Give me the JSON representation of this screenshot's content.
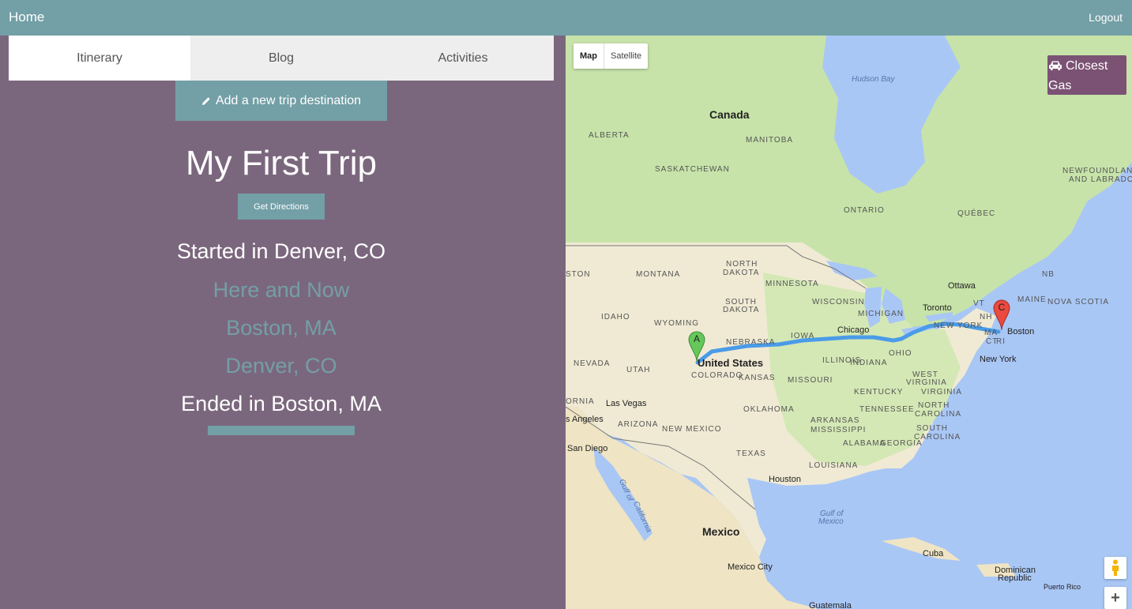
{
  "navbar": {
    "home_label": "Home",
    "logout_label": "Logout"
  },
  "tabs": [
    {
      "label": "Itinerary",
      "active": true
    },
    {
      "label": "Blog",
      "active": false
    },
    {
      "label": "Activities",
      "active": false
    }
  ],
  "actions": {
    "add_destination_label": "Add a new trip destination",
    "get_directions_label": "Get Directions"
  },
  "trip": {
    "title": "My First Trip",
    "start_text": "Started in Denver, CO",
    "stops": [
      "Here and Now",
      "Boston, MA",
      "Denver, CO"
    ],
    "end_text": "Ended in Boston, MA"
  },
  "map": {
    "type_controls": {
      "map_label": "Map",
      "satellite_label": "Satellite",
      "selected": "Map"
    },
    "closest_gas_label": "Closest Gas",
    "markers": {
      "a_label": "A",
      "c_label": "C"
    },
    "labels": {
      "hudson_bay": "Hudson Bay",
      "canada": "Canada",
      "alberta": "ALBERTA",
      "manitoba": "MANITOBA",
      "saskatchewan": "SASKATCHEWAN",
      "ontario": "ONTARIO",
      "quebec": "QUÉBEC",
      "newfoundland1": "NEWFOUNDLAND",
      "newfoundland2": "AND LABRADOR",
      "north_dakota1": "NORTH",
      "north_dakota2": "DAKOTA",
      "montana": "MONTANA",
      "minnesota": "MINNESOTA",
      "ston": "STON",
      "ottawa": "Ottawa",
      "nb": "NB",
      "south_dakota1": "SOUTH",
      "south_dakota2": "DAKOTA",
      "wisconsin": "WISCONSIN",
      "toronto": "Toronto",
      "vt": "VT",
      "maine": "MAINE",
      "nova_scotia": "NOVA SCOTIA",
      "idaho": "IDAHO",
      "wyoming": "WYOMING",
      "michigan": "MICHIGAN",
      "nh": "NH",
      "new_york_state": "NEW YORK",
      "iowa": "IOWA",
      "chicago": "Chicago",
      "nebraska": "NEBRASKA",
      "ma": "MA",
      "boston": "Boston",
      "ct": "CT",
      "ri": "RI",
      "united_states": "United States",
      "nevada": "NEVADA",
      "utah": "UTAH",
      "colorado": "COLORADO",
      "illinois": "ILLINOIS",
      "indiana": "INDIANA",
      "ohio": "OHIO",
      "new_york_city": "New York",
      "kansas": "KANSAS",
      "missouri": "MISSOURI",
      "west_virginia1": "WEST",
      "west_virginia2": "VIRGINIA",
      "virginia": "VIRGINIA",
      "kentucky": "KENTUCKY",
      "ornia": "ORNIA",
      "las_vegas": "Las Vegas",
      "los_angeles": "s Angeles",
      "arizona": "ARIZONA",
      "oklahoma": "OKLAHOMA",
      "arkansas": "ARKANSAS",
      "tennessee": "TENNESSEE",
      "north_carolina1": "NORTH",
      "north_carolina2": "CAROLINA",
      "south_carolina1": "SOUTH",
      "south_carolina2": "CAROLINA",
      "new_mexico": "NEW MEXICO",
      "mississippi": "MISSISSIPPI",
      "alabama": "ALABAMA",
      "georgia": "GEORGIA",
      "san_diego": "San Diego",
      "texas": "TEXAS",
      "louisiana": "LOUISIANA",
      "houston": "Houston",
      "gulf_of_california1": "Gulf of",
      "gulf_of_california2": "California",
      "gulf_of_mexico1": "Gulf of",
      "gulf_of_mexico2": "Mexico",
      "mexico": "Mexico",
      "cuba": "Cuba",
      "dominican1": "Dominican",
      "dominican2": "Republic",
      "puerto_rico": "Puerto Rico",
      "mexico_city": "Mexico City",
      "guatemala": "Guatemala"
    }
  }
}
